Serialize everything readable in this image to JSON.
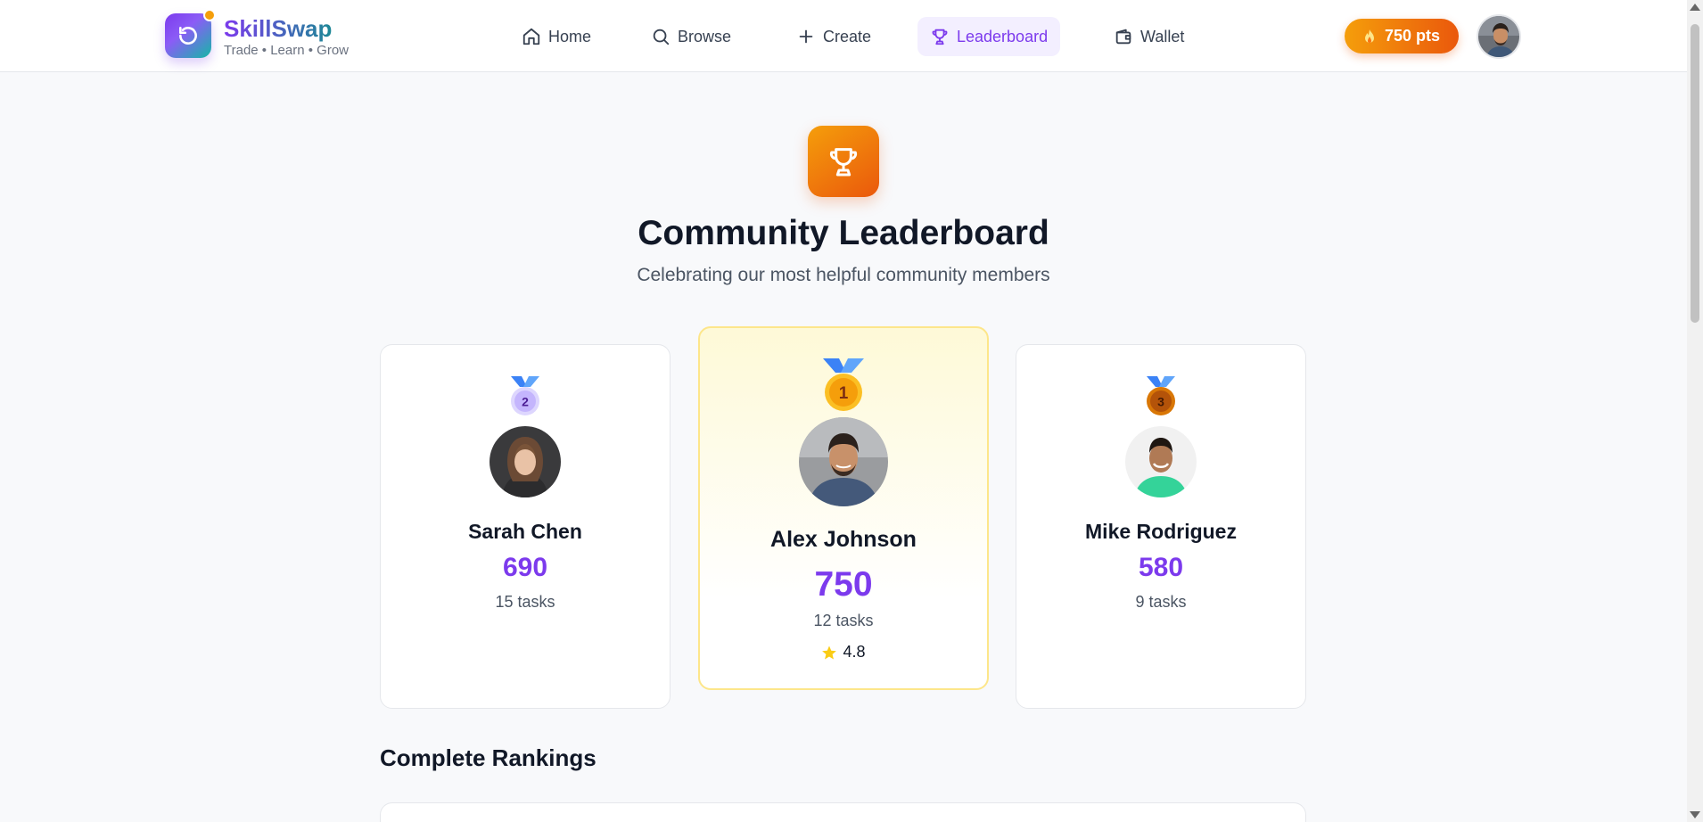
{
  "app": {
    "name": "SkillSwap",
    "tagline": "Trade • Learn • Grow"
  },
  "nav": {
    "home": "Home",
    "browse": "Browse",
    "create": "Create",
    "leaderboard": "Leaderboard",
    "wallet": "Wallet",
    "active": "leaderboard"
  },
  "user": {
    "points": "750 pts"
  },
  "hero": {
    "title": "Community Leaderboard",
    "subtitle": "Celebrating our most helpful community members"
  },
  "podium": {
    "second": {
      "rank": "2",
      "name": "Sarah Chen",
      "score": "690",
      "tasks": "15 tasks"
    },
    "first": {
      "rank": "1",
      "name": "Alex Johnson",
      "score": "750",
      "tasks": "12 tasks",
      "rating": "4.8"
    },
    "third": {
      "rank": "3",
      "name": "Mike Rodriguez",
      "score": "580",
      "tasks": "9 tasks"
    }
  },
  "rankings": {
    "title": "Complete Rankings"
  },
  "colors": {
    "accent": "#7c3aed",
    "gold": "#f59e0b",
    "orange": "#ea580c",
    "teal": "#0d9488",
    "silver": "#c4b5fd",
    "bronze": "#b45309"
  },
  "icons": [
    "refresh-icon",
    "home-icon",
    "search-icon",
    "plus-icon",
    "trophy-icon",
    "wallet-icon",
    "fire-icon",
    "medal-icon",
    "star-icon"
  ]
}
